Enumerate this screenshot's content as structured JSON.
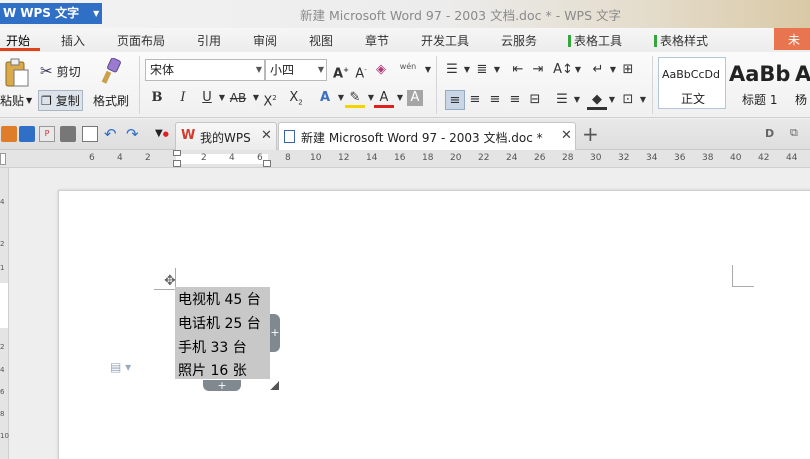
{
  "app": {
    "name": "WPS 文字",
    "logo": "W"
  },
  "window_title": "新建 Microsoft Word 97 - 2003 文档.doc * - WPS 文字",
  "menu": {
    "tabs": [
      "开始",
      "插入",
      "页面布局",
      "引用",
      "审阅",
      "视图",
      "章节",
      "开发工具",
      "云服务",
      "表格工具",
      "表格样式"
    ],
    "corner_label": "未"
  },
  "ribbon": {
    "paste_label": "粘贴",
    "cut_label": "剪切",
    "copy_label": "复制",
    "format_painter_label": "格式刷",
    "font_name": "宋体",
    "font_size": "小四",
    "wen_label": "wén",
    "styles": [
      {
        "sample": "AaBbCcDd",
        "name": "正文"
      },
      {
        "sample": "AaBb",
        "name": "标题 1"
      },
      {
        "sample": "A",
        "name": "杨"
      }
    ]
  },
  "tabs": {
    "home_tab_label": "我的WPS",
    "doc_tab_label": "新建 Microsoft Word 97 - 2003 文档.doc *",
    "add_label": "+"
  },
  "ruler": {
    "labels": [
      "6",
      "4",
      "2",
      "2",
      "4",
      "6",
      "8",
      "10",
      "12",
      "14",
      "16",
      "18",
      "20",
      "22",
      "24",
      "26",
      "28",
      "30",
      "32",
      "34",
      "36",
      "38",
      "40",
      "42",
      "44"
    ],
    "vertical_labels": [
      "4",
      "2",
      "1",
      "2",
      "4",
      "6",
      "8",
      "10"
    ]
  },
  "table": {
    "rows": [
      "电视机 45 台",
      "电话机 25 台",
      "手机 33 台",
      "照片 16 张"
    ],
    "row_handle_label": "+",
    "col_handle_label": "+"
  },
  "colors": {
    "accent": "#2f6fc6",
    "active_tab_underline": "#e0421b",
    "table_select": "#c8c8c8"
  }
}
